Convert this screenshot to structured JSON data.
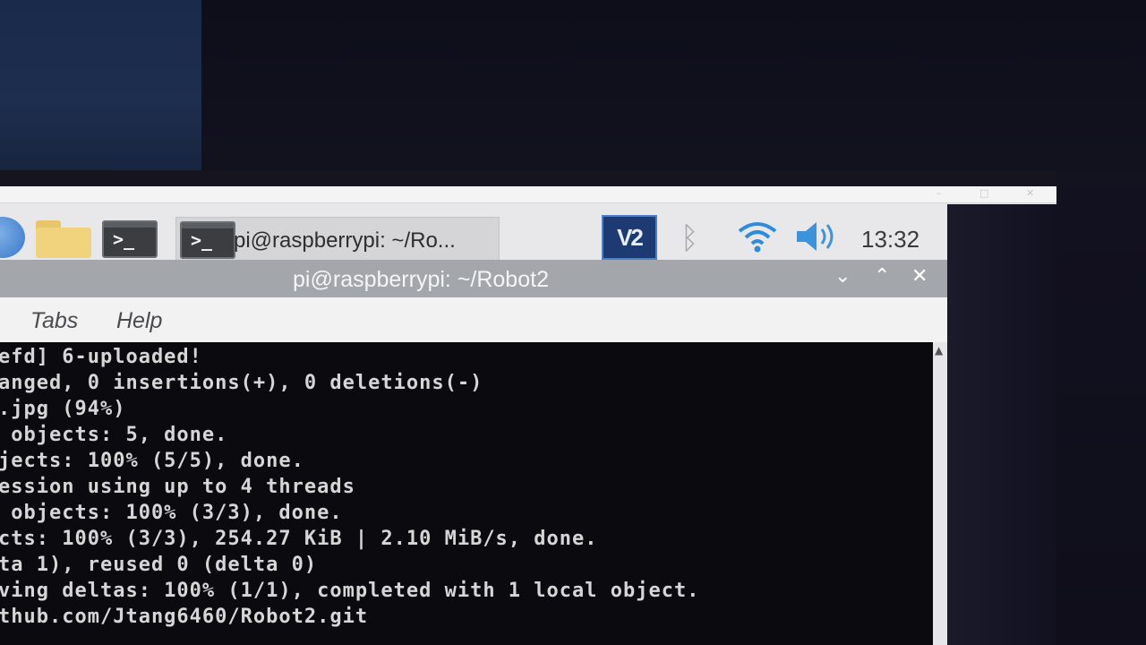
{
  "taskbar": {
    "icons": [
      "globe-icon",
      "folder-icon",
      "terminal-icon"
    ],
    "task_label": "pi@raspberrypi: ~/Ro...",
    "tray": {
      "vnc_label": "V2",
      "bluetooth_icon": "bluetooth-icon",
      "wifi_icon": "wifi-icon",
      "volume_icon": "volume-icon"
    },
    "clock": "13:32"
  },
  "window": {
    "title": "pi@raspberrypi: ~/Robot2",
    "controls": {
      "minimize": "⌄",
      "maximize": "⌃",
      "close": "✕"
    },
    "menu": [
      "Tabs",
      "Help"
    ]
  },
  "terminal": {
    "lines": [
      "efd] 6-uploaded!",
      "anged, 0 insertions(+), 0 deletions(-)",
      ".jpg (94%)",
      " objects: 5, done.",
      "jects: 100% (5/5), done.",
      "ession using up to 4 threads",
      " objects: 100% (3/3), done.",
      "cts: 100% (3/3), 254.27 KiB | 2.10 MiB/s, done.",
      "ta 1), reused 0 (delta 0)",
      "ving deltas: 100% (1/1), completed with 1 local object.",
      "thub.com/Jtang6460/Robot2.git"
    ]
  },
  "colors": {
    "taskbar_bg": "#e8e8ea",
    "titlebar_bg": "#a3a6ab",
    "terminal_bg": "#0a0a0f",
    "terminal_fg": "#d6d6d6",
    "vnc_bg": "#1d3b72"
  }
}
